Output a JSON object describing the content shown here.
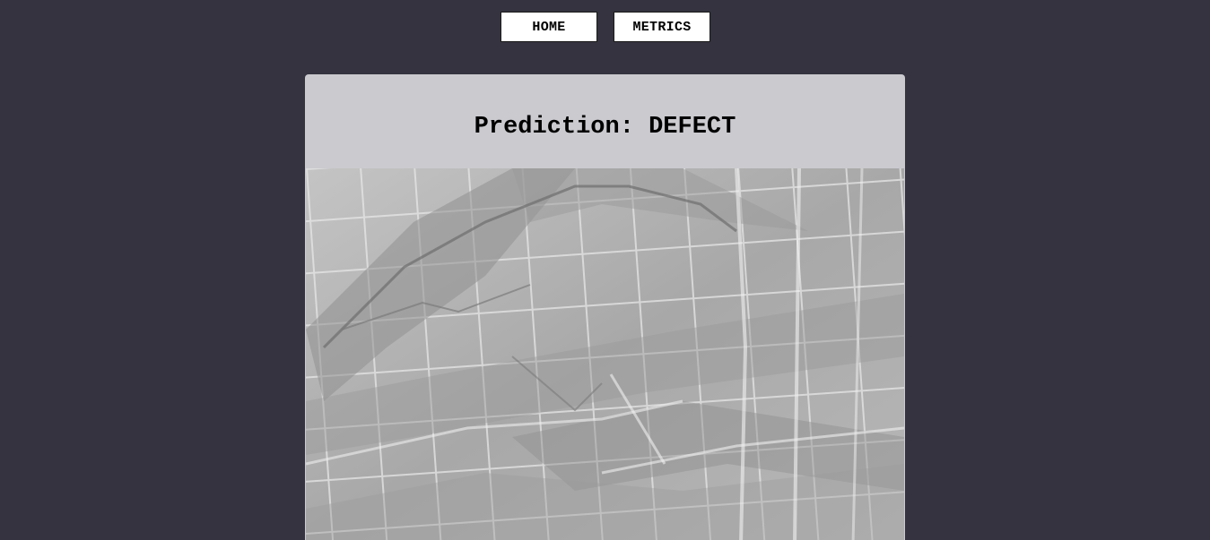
{
  "nav": {
    "home_label": "HOME",
    "metrics_label": "METRICS"
  },
  "result": {
    "title": "Prediction: DEFECT"
  },
  "colors": {
    "background": "#34333f",
    "card": "#cbcacf",
    "button": "#ffffff"
  }
}
